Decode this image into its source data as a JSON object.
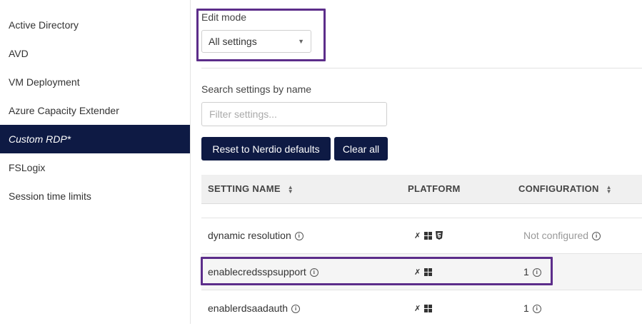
{
  "sidebar": {
    "items": [
      {
        "label": "Active Directory"
      },
      {
        "label": "AVD"
      },
      {
        "label": "VM Deployment"
      },
      {
        "label": "Azure Capacity Extender"
      },
      {
        "label": "Custom RDP*",
        "active": true
      },
      {
        "label": "FSLogix"
      },
      {
        "label": "Session time limits"
      }
    ]
  },
  "edit_mode": {
    "label": "Edit mode",
    "selected": "All settings"
  },
  "search": {
    "label": "Search settings by name",
    "placeholder": "Filter settings..."
  },
  "buttons": {
    "reset": "Reset to Nerdio defaults",
    "clear": "Clear all"
  },
  "table": {
    "headers": {
      "setting_name": "SETTING NAME",
      "platform": "PLATFORM",
      "configuration": "CONFIGURATION"
    },
    "rows": [
      {
        "name": "dynamic resolution",
        "platforms": [
          "x-icon",
          "windows-icon",
          "html5-icon"
        ],
        "config": "Not configured"
      },
      {
        "name": "enablecredsspsupport",
        "platforms": [
          "x-icon",
          "windows-icon"
        ],
        "config": "1"
      },
      {
        "name": "enablerdsaadauth",
        "platforms": [
          "x-icon",
          "windows-icon"
        ],
        "config": "1"
      }
    ]
  },
  "colors": {
    "navy": "#0e1a44",
    "highlight": "#5c2d8a"
  }
}
